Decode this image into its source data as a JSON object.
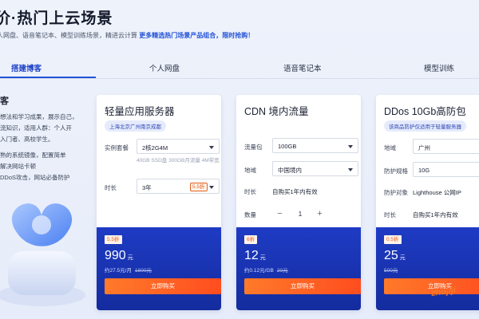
{
  "hero": {
    "title": "价·热门上云场景",
    "subtitle_lead": "人网盘、语音笔记本、模型训练场景，精进云计算",
    "subtitle_link": "更多精选热门场景产品组合，限时抢购！"
  },
  "tabs": [
    {
      "label": "搭建博客",
      "active": true
    },
    {
      "label": "个人网盘",
      "active": false
    },
    {
      "label": "语音笔记本",
      "active": false
    },
    {
      "label": "模型训练",
      "active": false
    }
  ],
  "left_panel": {
    "heading": "客",
    "lines": [
      "想法和学习成果，展示自己，",
      "流知识，适用人群：个人开",
      "入门者、高校学生。",
      "",
      "熟的系统镜像，配置简单",
      "解决网站卡顿",
      "DDoS攻击，网站必备防护"
    ]
  },
  "cards": [
    {
      "title": "轻量应用服务器",
      "tag": "上海北京广州南京成都",
      "spec_label": "实例套餐",
      "spec_value": "2核2G4M",
      "spec_hint": "40GB SSD盘 300GB月流量 4M带宽",
      "duration_label": "时长",
      "duration_value": "3年",
      "duration_discount": "5.5折",
      "price_badge": "5.5折",
      "price": "990",
      "price_unit": "元",
      "price_sub": "约27.5元/月",
      "price_original": "1800元",
      "buy_label": "立即购买"
    },
    {
      "title": "CDN 境内流量",
      "package_label": "流量包",
      "package_value": "100GB",
      "region_label": "地域",
      "region_value": "中国境内",
      "duration_label": "时长",
      "duration_value": "自购买1年内有效",
      "qty_label": "数量",
      "qty_value": "1",
      "price_badge": "6折",
      "price": "12",
      "price_unit": "元",
      "price_sub": "约0.12元/GB",
      "price_original": "20元",
      "buy_label": "立即购买"
    },
    {
      "title": "DDos 10Gb高防包",
      "tag": "该商品防护仅适用于轻量服务器",
      "region_label": "地域",
      "region_value": "广州",
      "spec_label": "防护规格",
      "spec_value": "10G",
      "target_label": "防护对象",
      "target_value": "Lighthouse 公网IP",
      "duration_label": "时长",
      "duration_value": "自购买1年内有效",
      "price_badge": "0.5折",
      "price": "25",
      "price_unit": "元",
      "price_original": "500元",
      "buy_label": "立即购买"
    }
  ],
  "watermark": "zhujiji"
}
